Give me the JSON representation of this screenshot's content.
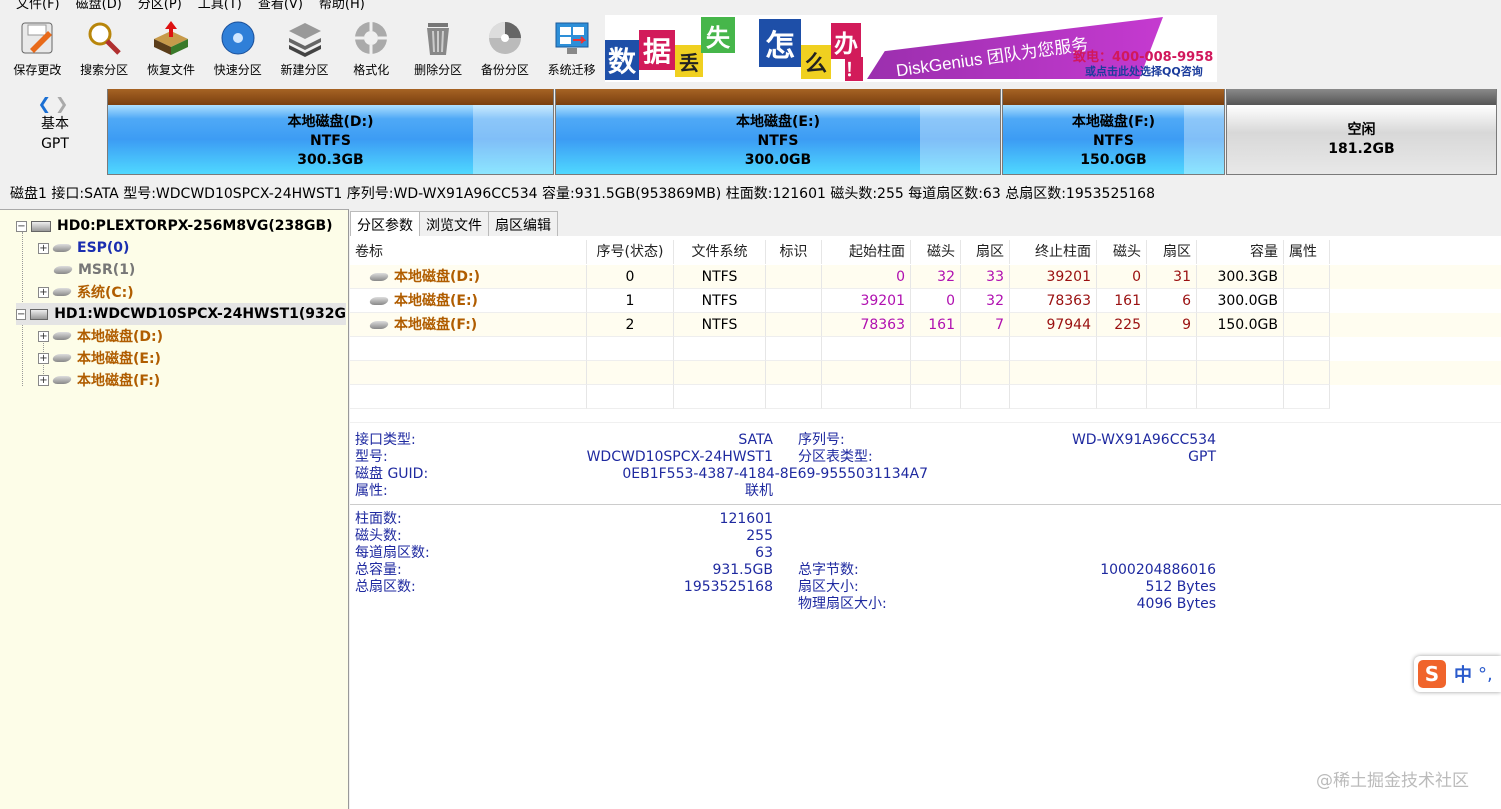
{
  "menu": [
    "文件(F)",
    "磁盘(D)",
    "分区(P)",
    "工具(T)",
    "查看(V)",
    "帮助(H)"
  ],
  "toolbar": [
    {
      "label": "保存更改",
      "icon": "save-icon"
    },
    {
      "label": "搜索分区",
      "icon": "search-icon"
    },
    {
      "label": "恢复文件",
      "icon": "recover-icon"
    },
    {
      "label": "快速分区",
      "icon": "quick-partition-icon"
    },
    {
      "label": "新建分区",
      "icon": "new-partition-icon"
    },
    {
      "label": "格式化",
      "icon": "format-icon"
    },
    {
      "label": "删除分区",
      "icon": "delete-icon"
    },
    {
      "label": "备份分区",
      "icon": "backup-icon"
    },
    {
      "label": "系统迁移",
      "icon": "migrate-icon"
    }
  ],
  "banner": {
    "tiles": [
      "数",
      "据",
      "丢",
      "失",
      "怎",
      "么",
      "办",
      "！"
    ],
    "slogan": "DiskGenius 团队为您服务",
    "phone": "致电：400-008-9958",
    "qq": "或点击此处选择QQ咨询"
  },
  "disk_nav": {
    "line1": "基本",
    "line2": "GPT"
  },
  "partitions": [
    {
      "name": "本地磁盘(D:)",
      "fs": "NTFS",
      "size": "300.3GB"
    },
    {
      "name": "本地磁盘(E:)",
      "fs": "NTFS",
      "size": "300.0GB"
    },
    {
      "name": "本地磁盘(F:)",
      "fs": "NTFS",
      "size": "150.0GB"
    },
    {
      "name": "空闲",
      "fs": "",
      "size": "181.2GB"
    }
  ],
  "info_line": "磁盘1 接口:SATA  型号:WDCWD10SPCX-24HWST1  序列号:WD-WX91A96CC534  容量:931.5GB(953869MB)  柱面数:121601  磁头数:255  每道扇区数:63  总扇区数:1953525168",
  "tree": [
    {
      "label": "HD0:PLEXTORPX-256M8VG(238GB)"
    },
    {
      "label": "ESP(0)"
    },
    {
      "label": "MSR(1)"
    },
    {
      "label": "系统(C:)"
    },
    {
      "label": "HD1:WDCWD10SPCX-24HWST1(932G"
    },
    {
      "label": "本地磁盘(D:)"
    },
    {
      "label": "本地磁盘(E:)"
    },
    {
      "label": "本地磁盘(F:)"
    }
  ],
  "tabs": [
    "分区参数",
    "浏览文件",
    "扇区编辑"
  ],
  "table": {
    "headers": [
      "卷标",
      "序号(状态)",
      "文件系统",
      "标识",
      "起始柱面",
      "磁头",
      "扇区",
      "终止柱面",
      "磁头",
      "扇区",
      "容量",
      "属性"
    ],
    "rows": [
      [
        "本地磁盘(D:)",
        "0",
        "NTFS",
        "",
        "0",
        "32",
        "33",
        "39201",
        "0",
        "31",
        "300.3GB",
        ""
      ],
      [
        "本地磁盘(E:)",
        "1",
        "NTFS",
        "",
        "39201",
        "0",
        "32",
        "78363",
        "161",
        "6",
        "300.0GB",
        ""
      ],
      [
        "本地磁盘(F:)",
        "2",
        "NTFS",
        "",
        "78363",
        "161",
        "7",
        "97944",
        "225",
        "9",
        "150.0GB",
        ""
      ]
    ]
  },
  "details": {
    "interface_label": "接口类型:",
    "interface_value": "SATA",
    "serial_label": "序列号:",
    "serial_value": "WD-WX91A96CC534",
    "model_label": "型号:",
    "model_value": "WDCWD10SPCX-24HWST1",
    "ptable_label": "分区表类型:",
    "ptable_value": "GPT",
    "guid_label": "磁盘 GUID:",
    "guid_value": "0EB1F553-4387-4184-8E69-9555031134A7",
    "attr_label": "属性:",
    "attr_value": "联机",
    "cyl_label": "柱面数:",
    "cyl_value": "121601",
    "heads_label": "磁头数:",
    "heads_value": "255",
    "spt_label": "每道扇区数:",
    "spt_value": "63",
    "cap_label": "总容量:",
    "cap_value": "931.5GB",
    "bytes_label": "总字节数:",
    "bytes_value": "1000204886016",
    "sectors_label": "总扇区数:",
    "sectors_value": "1953525168",
    "secsize_label": "扇区大小:",
    "secsize_value": "512 Bytes",
    "physsec_label": "物理扇区大小:",
    "physsec_value": "4096 Bytes"
  },
  "ime": {
    "logo": "S",
    "mode": "中",
    "punct": "°,"
  },
  "watermark": "@稀土掘金技术社区"
}
